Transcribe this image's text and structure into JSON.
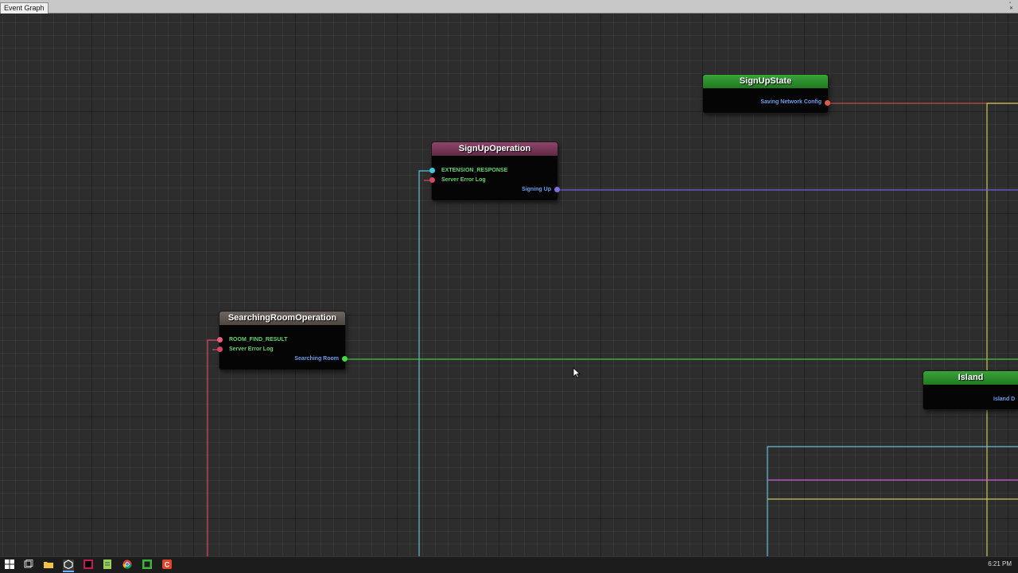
{
  "window": {
    "tab_label": "Event Graph",
    "controls_glyph": "▫ ✕"
  },
  "nodes": {
    "signup_state": {
      "title": "SignUpState",
      "header_color": "#2b8d2b",
      "outputs": [
        {
          "label": "Saving Network Config",
          "label_color": "#6f9ded",
          "pin_color": "#e0584a"
        }
      ]
    },
    "signup_operation": {
      "title": "SignUpOperation",
      "header_color": "#7d3a5c",
      "inputs": [
        {
          "label": "EXTENSION_RESPONSE",
          "label_color": "#67d36e",
          "pin_color": "#3fc8e0"
        },
        {
          "label": "Server Error Log",
          "label_color": "#67d36e",
          "pin_color": "#d64660"
        }
      ],
      "outputs": [
        {
          "label": "Signing Up",
          "label_color": "#6f9ded",
          "pin_color": "#7a6fe3"
        }
      ]
    },
    "searching_room_operation": {
      "title": "SearchingRoomOperation",
      "header_color": "#5f5550",
      "inputs": [
        {
          "label": "ROOM_FIND_RESULT",
          "label_color": "#67d36e",
          "pin_color": "#e4607e"
        },
        {
          "label": "Server Error Log",
          "label_color": "#67d36e",
          "pin_color": "#d64660"
        }
      ],
      "outputs": [
        {
          "label": "Searching Room",
          "label_color": "#6f9ded",
          "pin_color": "#42dc42"
        }
      ]
    },
    "island": {
      "title": "Island",
      "header_color": "#2b8d2b",
      "outputs": [
        {
          "label": "Island D",
          "label_color": "#6f9ded",
          "pin_color": "#6f9ded"
        }
      ]
    }
  },
  "wire_colors": {
    "red": "#c54b48",
    "yellow": "#c8c85a",
    "purple": "#6f64d8",
    "cyan": "#5fbfd8",
    "pink": "#d8486a",
    "green": "#42c442",
    "magenta": "#d65ad8"
  },
  "taskbar": {
    "icons": [
      "windows-start-icon",
      "task-view-icon",
      "file-explorer-icon",
      "unity-icon",
      "rider-icon",
      "notepad-icon",
      "chrome-icon",
      "terminal-icon",
      "app-icon"
    ],
    "clock": "6:21 PM"
  }
}
